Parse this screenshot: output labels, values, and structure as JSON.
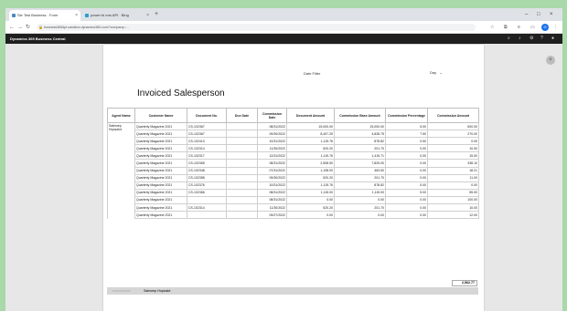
{
  "browser": {
    "tabs": [
      {
        "label": "Sie Test Business · Form"
      },
      {
        "label": "power bi mrs API · Bing"
      }
    ],
    "url": "business365dpt.sandbox.dynamics365.com/?company=…"
  },
  "app": {
    "title": "Dynamics 365 Business Central"
  },
  "report": {
    "date_filter_label": "Date Filter",
    "date_filter_value": "",
    "date_select": "Day",
    "heading": "Invoiced Salesperson",
    "columns": [
      "Agent Name",
      "Customer Name",
      "Document No.",
      "Due Date",
      "Commission Date",
      "Document Amount",
      "Commission Base Amount",
      "Commission Percentage",
      "Commission Amount"
    ],
    "agent": "Salesrep Hopsalot",
    "rows": [
      [
        "Quarterly Magazine 2021",
        "CS-102367",
        "",
        "08/31/2022",
        "15,000.00",
        "15,000.00",
        "5.00",
        "500.00"
      ],
      [
        "Quarterly Magazine 2021",
        "CS-102367",
        "",
        "09/30/2022",
        "8,497.25",
        "4,828.75",
        "7.50",
        "270.00"
      ],
      [
        "Quarterly Magazine 2021",
        "CS-102413",
        "",
        "10/31/2022",
        "1,115.76",
        "878.82",
        "0.50",
        "0.00"
      ],
      [
        "Quarterly Magazine 2021",
        "CS-102314",
        "",
        "11/30/2022",
        "520.20",
        "201.70",
        "0.00",
        "10.00"
      ],
      [
        "Quarterly Magazine 2021",
        "CS-102317",
        "",
        "12/31/2022",
        "1,115.76",
        "1,415.71",
        "0.00",
        "15.00"
      ],
      [
        "Quarterly Magazine 2021",
        "CS-102365",
        "",
        "08/31/2022",
        "2,508.50",
        "7,825.00",
        "0.00",
        "338.10"
      ],
      [
        "Quarterly Magazine 2021",
        "CS-102348",
        "",
        "07/31/2022",
        "1,108.00",
        "463.50",
        "0.00",
        "18.21"
      ],
      [
        "Quarterly Magazine 2021",
        "CS-102358",
        "",
        "09/30/2022",
        "520.20",
        "201.70",
        "0.00",
        "11.00"
      ],
      [
        "Quarterly Magazine 2021",
        "CS-102376",
        "",
        "10/31/2022",
        "1,115.76",
        "878.82",
        "0.00",
        "0.00"
      ],
      [
        "Quarterly Magazine 2021",
        "CS-102366",
        "",
        "08/31/2022",
        "1,115.00",
        "1,115.00",
        "5.00",
        "55.00"
      ],
      [
        "Quarterly Magazine 2021",
        "",
        "",
        "08/31/2022",
        "0.00",
        "0.00",
        "0.00",
        "100.00"
      ],
      [
        "Quarterly Magazine 2021",
        "CS-102314",
        "",
        "11/30/2022",
        "520.20",
        "201.70",
        "0.00",
        "10.00"
      ],
      [
        "Quarterly Magazine 2021",
        "",
        "",
        "09/27/2022",
        "0.00",
        "0.00",
        "0.00",
        "12.00"
      ]
    ],
    "total": "2,562.77",
    "footer_label": "Salesrep Hopsalot"
  }
}
